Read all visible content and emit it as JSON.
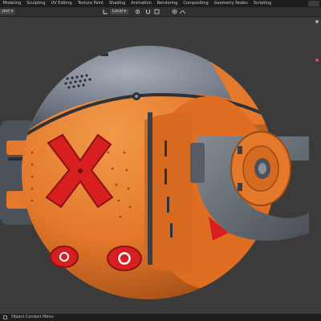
{
  "workspace_tabs": [
    "Modeling",
    "Sculpting",
    "UV Editing",
    "Texture Paint",
    "Shading",
    "Animation",
    "Rendering",
    "Compositing",
    "Geometry Nodes",
    "Scripting"
  ],
  "active_tab_index": -1,
  "header": {
    "mode_label": "ject",
    "transform_orientation": "Local"
  },
  "status": {
    "context_menu": "Object Context Menu"
  },
  "icons": {
    "orientation": "axis-icon",
    "snap": "magnet-icon",
    "proportional": "circle-dot-icon",
    "status_mouse": "mouse-icon"
  },
  "colors": {
    "body_orange": "#e4782b",
    "shell_gray": "#6b7280",
    "x_red": "#d81f1f",
    "viewport_bg": "#3b3b3b"
  }
}
